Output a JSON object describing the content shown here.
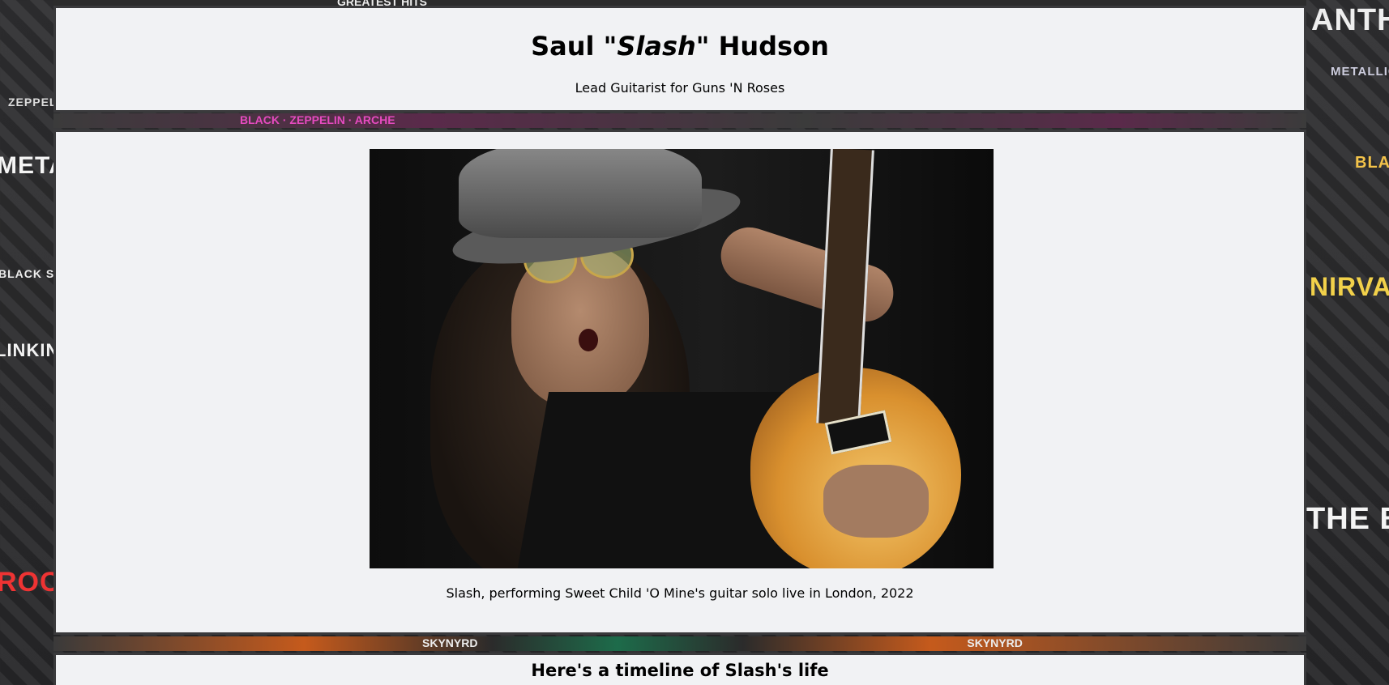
{
  "header": {
    "title_first": "Saul",
    "title_nick": "\"Slash\"",
    "title_last": "Hudson",
    "subtitle": "Lead Guitarist for Guns 'N Roses"
  },
  "photo": {
    "caption": "Slash, performing Sweet Child 'O Mine's guitar solo live in London, 2022"
  },
  "timeline": {
    "heading": "Here's a timeline of Slash's life"
  },
  "background": {
    "strip_top": "GREATEST HITS",
    "strip_mid": "BLACK  ·  ZEPPELIN  ·  ARCHE",
    "strip_low": "SKYNYRD",
    "left_labels": [
      "METAL",
      "ZEPPELIN",
      "BLACK SABBATH",
      "LINKIN PARK",
      "ROCK"
    ],
    "right_labels": [
      "ANTHRAX",
      "METALLICA",
      "BLACK SABBATH",
      "NIRVANA",
      "THE BEATLES"
    ]
  }
}
